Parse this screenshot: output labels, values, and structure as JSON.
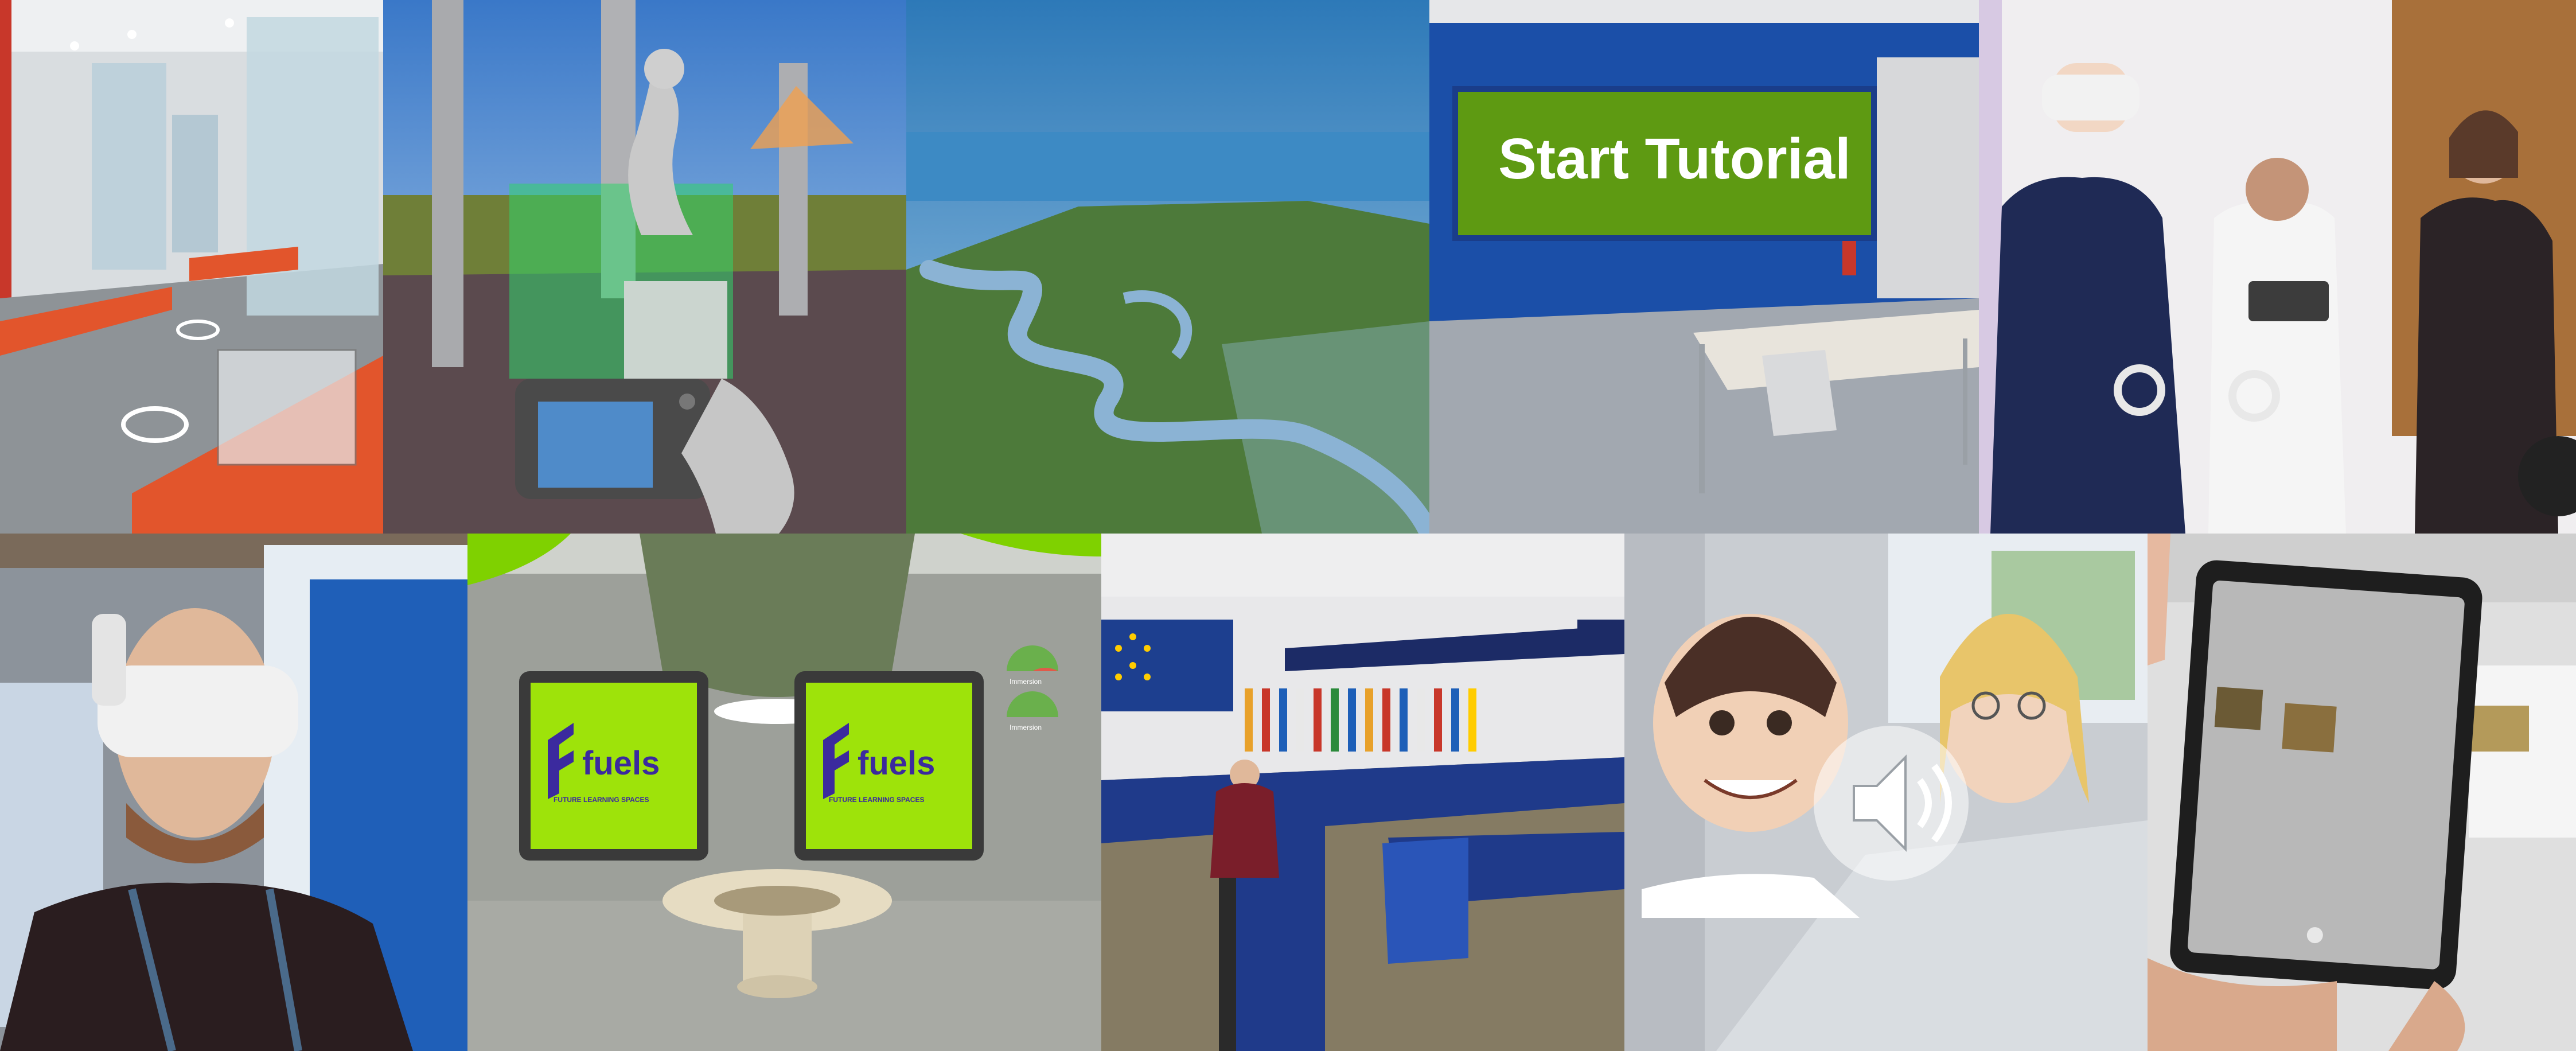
{
  "tutorial": {
    "label": "Start Tutorial"
  },
  "fuels": {
    "brand": "fuels",
    "tagline": "FUTURE LEARNING SPACES",
    "gauge_label": "Immersion"
  },
  "colors": {
    "tutorial_green": "#5e9a12",
    "tutorial_blue": "#1b4fa8",
    "fuels_screen_green": "#9ee30a",
    "fuels_logo_purple": "#3b2a9e",
    "eu_blue": "#1d3f8f",
    "exhibit_orange": "#e2552c"
  },
  "icons": {
    "speaker": "speaker-icon",
    "camera": "camera-icon",
    "eu_flag": "eu-flag-icon",
    "fuels_logo": "fuels-logo-icon"
  }
}
